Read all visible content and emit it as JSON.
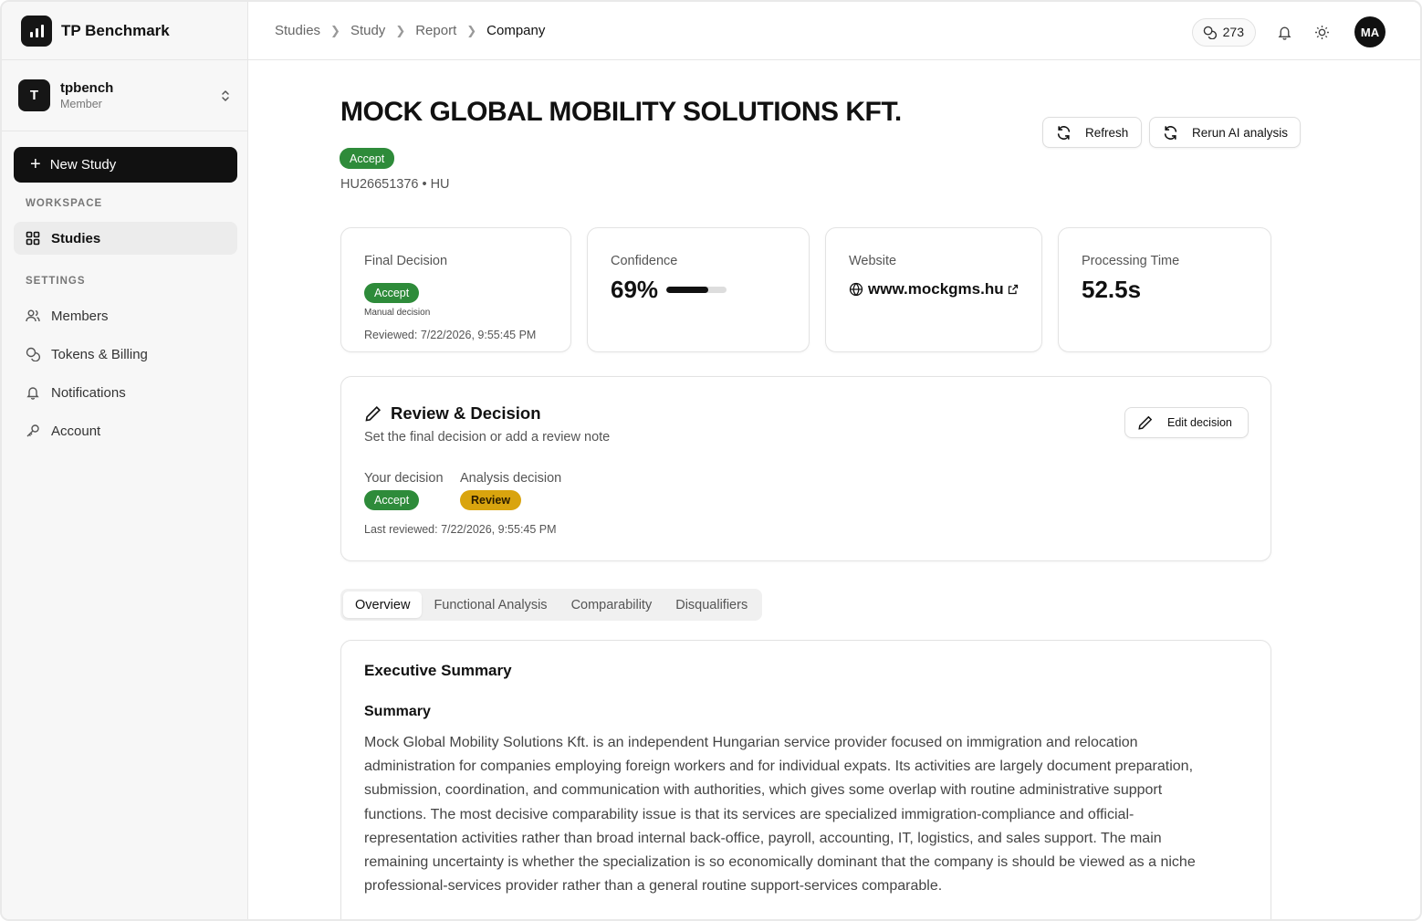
{
  "app": {
    "name": "TP Benchmark"
  },
  "org": {
    "avatar_letter": "T",
    "name": "tpbench",
    "role": "Member"
  },
  "sidebar": {
    "new_study_label": "New Study",
    "workspace_label": "WORKSPACE",
    "workspace_items": [
      {
        "label": "Studies",
        "icon": "grid-icon",
        "active": true
      }
    ],
    "settings_label": "SETTINGS",
    "settings_items": [
      {
        "label": "Members",
        "icon": "users-icon"
      },
      {
        "label": "Tokens & Billing",
        "icon": "coins-icon"
      },
      {
        "label": "Notifications",
        "icon": "bell-icon"
      },
      {
        "label": "Account",
        "icon": "key-icon"
      }
    ]
  },
  "breadcrumb": [
    "Studies",
    "Study",
    "Report",
    "Company"
  ],
  "topbar": {
    "tokens": "273",
    "user_initials": "MA"
  },
  "company": {
    "name": "MOCK GLOBAL MOBILITY SOLUTIONS KFT.",
    "status": "Accept",
    "meta": "HU26651376 • HU"
  },
  "actions": {
    "refresh_label": "Refresh",
    "rerun_label": "Rerun AI analysis"
  },
  "stats": {
    "final_decision": {
      "label": "Final Decision",
      "badge": "Accept",
      "note": "Manual decision",
      "reviewed": "Reviewed: 7/22/2026, 9:55:45 PM"
    },
    "confidence": {
      "label": "Confidence",
      "value": "69%",
      "fraction": 0.69
    },
    "website": {
      "label": "Website",
      "url": "www.mockgms.hu"
    },
    "processing_time": {
      "label": "Processing Time",
      "value": "52.5s"
    }
  },
  "review": {
    "title": "Review & Decision",
    "subtitle": "Set the final decision or add a review note",
    "edit_label": "Edit decision",
    "your_decision_label": "Your decision",
    "your_decision": "Accept",
    "analysis_decision_label": "Analysis decision",
    "analysis_decision": "Review",
    "last_reviewed": "Last reviewed: 7/22/2026, 9:55:45 PM"
  },
  "tabs": [
    "Overview",
    "Functional Analysis",
    "Comparability",
    "Disqualifiers"
  ],
  "executive_summary": {
    "title": "Executive Summary",
    "subtitle": "Summary",
    "text": "Mock Global Mobility Solutions Kft. is an independent Hungarian service provider focused on immigration and relocation administration for companies employing foreign workers and for individual expats. Its activities are largely document preparation, submission, coordination, and communication with authorities, which gives some overlap with routine administrative support functions. The most decisive comparability issue is that its services are specialized immigration-compliance and official-representation activities rather than broad internal back-office, payroll, accounting, IT, logistics, and sales support. The main remaining uncertainty is whether the specialization is so economically dominant that the company is should be viewed as a niche professional-services provider rather than a general routine support-services comparable."
  },
  "colors": {
    "accept": "#2e8b3a",
    "review": "#d9a40e",
    "primary": "#111111"
  }
}
